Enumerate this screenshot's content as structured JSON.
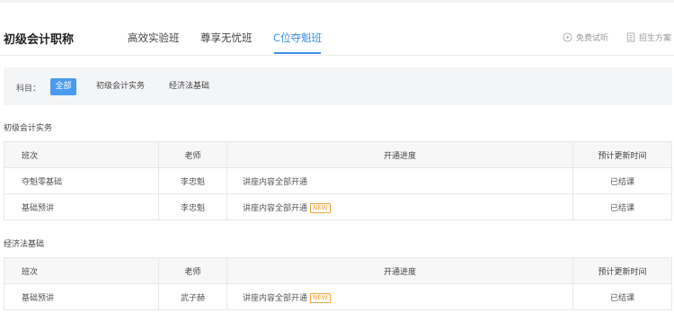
{
  "course": {
    "title": "初级会计职称"
  },
  "tabs": [
    {
      "label": "高效实验班"
    },
    {
      "label": "尊享无忧班"
    },
    {
      "label": "C位夺魁班",
      "active": true
    }
  ],
  "right_links": [
    {
      "label": "免费试听",
      "icon": "play-circle-icon"
    },
    {
      "label": "招生方案",
      "icon": "document-icon"
    }
  ],
  "filter": {
    "label": "科目：",
    "chips": [
      {
        "label": "全部",
        "active": true
      },
      {
        "label": "初级会计实务"
      },
      {
        "label": "经济法基础"
      }
    ]
  },
  "colors": {
    "accent": "#3f8ee8",
    "chip_active": "#4a9bf0",
    "new_badge": "#f5a33a"
  },
  "sections": [
    {
      "title": "初级会计实务",
      "headers": [
        "班次",
        "老师",
        "开通进度",
        "预计更新时间"
      ],
      "rows": [
        {
          "class": "夺魁零基础",
          "teacher": "李忠魁",
          "progress": "讲座内容全部开通",
          "new": "",
          "update": "已结课"
        },
        {
          "class": "基础预讲",
          "teacher": "李忠魁",
          "progress": "讲座内容全部开通",
          "new": "NEW",
          "update": "已结课"
        }
      ]
    },
    {
      "title": "经济法基础",
      "headers": [
        "班次",
        "老师",
        "开通进度",
        "预计更新时间"
      ],
      "rows": [
        {
          "class": "基础预讲",
          "teacher": "武子赫",
          "progress": "讲座内容全部开通",
          "new": "NEW",
          "update": "已结课"
        }
      ]
    }
  ]
}
